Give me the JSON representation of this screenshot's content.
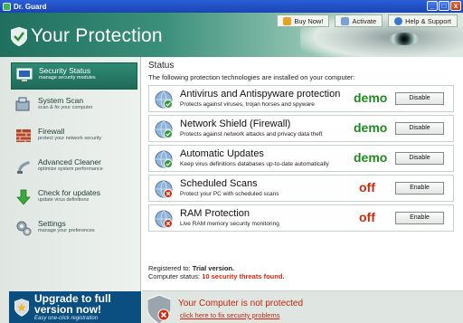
{
  "window": {
    "title": "Dr. Guard",
    "controls": [
      "_",
      "□",
      "x"
    ]
  },
  "header": {
    "title": "Your Protection",
    "links": [
      {
        "label": "Buy Now!",
        "icon": "cart-icon"
      },
      {
        "label": "Activate",
        "icon": "key-icon"
      },
      {
        "label": "Help & Support",
        "icon": "help-icon"
      }
    ]
  },
  "sidebar": {
    "items": [
      {
        "label": "Security Status",
        "sub": "manage security modules",
        "icon": "monitor-icon"
      },
      {
        "label": "System Scan",
        "sub": "scan & fix your computer",
        "icon": "scan-icon"
      },
      {
        "label": "Firewall",
        "sub": "protect your network security",
        "icon": "firewall-icon"
      },
      {
        "label": "Advanced Cleaner",
        "sub": "optimize system performance",
        "icon": "cleaner-icon"
      },
      {
        "label": "Check for updates",
        "sub": "update virus definitions",
        "icon": "update-icon"
      },
      {
        "label": "Settings",
        "sub": "manage your preferences",
        "icon": "settings-icon"
      }
    ],
    "upgrade": {
      "title": "Upgrade to full version now!",
      "sub": "Easy one-click registration"
    }
  },
  "main": {
    "title": "Status",
    "intro": "The following protection technologies are installed on your computer:",
    "rows": [
      {
        "title": "Antivirus and Antispyware protection",
        "desc": "Protects against viruses, trojan horses and spyware",
        "state": "demo",
        "button": "Disable",
        "ok": true
      },
      {
        "title": "Network Shield (Firewall)",
        "desc": "Protects against network attacks and privacy data theft",
        "state": "demo",
        "button": "Disable",
        "ok": true
      },
      {
        "title": "Automatic Updates",
        "desc": "Keep virus definitions databases up-to-date automatically",
        "state": "demo",
        "button": "Disable",
        "ok": true
      },
      {
        "title": "Scheduled Scans",
        "desc": "Protect your PC with scheduled scans",
        "state": "off",
        "button": "Enable",
        "ok": false
      },
      {
        "title": "RAM Protection",
        "desc": "Live RAM memory security monitoring",
        "state": "off",
        "button": "Enable",
        "ok": false
      }
    ],
    "registered_label": "Registered to:",
    "registered_value": "Trial version.",
    "computer_status_label": "Computer status:",
    "computer_status_value": "10 security threats found."
  },
  "alert": {
    "title": "Your Computer is not protected",
    "link": "click here to fix security problems"
  },
  "colors": {
    "accent": "#1f6a58",
    "demo": "#1f8a1f",
    "off": "#d0290a",
    "upgrade_bg": "#0b4f80"
  }
}
